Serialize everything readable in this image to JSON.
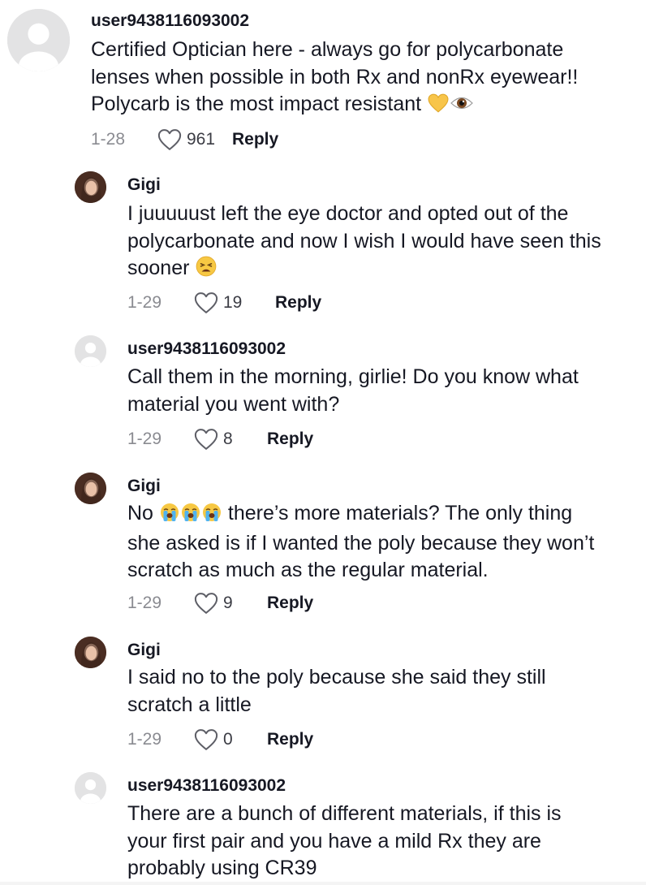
{
  "comments": [
    {
      "username": "user9438116093002",
      "avatar": "default-avatar-icon",
      "text_lines": [
        "Certified Optician here - always go for polycarbonate",
        "lenses when possible in both Rx and nonRx eyewear!!",
        "Polycarb is the most impact resistant"
      ],
      "emojis": [
        "yellow-heart-icon",
        "eye-icon"
      ],
      "date": "1-28",
      "likes": "961",
      "reply_label": "Reply"
    },
    {
      "username": "Gigi",
      "avatar": "profile-photo",
      "text_lines": [
        "I juuuuust left the eye doctor and opted out of the",
        "polycarbonate and now I wish I would have seen this",
        "sooner"
      ],
      "emojis": [
        "tired-face-icon"
      ],
      "date": "1-29",
      "likes": "19",
      "reply_label": "Reply"
    },
    {
      "username": "user9438116093002",
      "avatar": "default-avatar-icon",
      "text_lines": [
        "Call them in the morning, girlie! Do you know what",
        "material you went with?"
      ],
      "date": "1-29",
      "likes": "8",
      "reply_label": "Reply"
    },
    {
      "username": "Gigi",
      "avatar": "profile-photo",
      "text_prefix": "No",
      "text_first_rest": "there’s more materials? The only thing",
      "emojis": [
        "loudly-crying-face-icon",
        "loudly-crying-face-icon",
        "loudly-crying-face-icon"
      ],
      "text_lines": [
        "she asked is if I wanted the poly because they won’t",
        "scratch as much as the regular material."
      ],
      "date": "1-29",
      "likes": "9",
      "reply_label": "Reply"
    },
    {
      "username": "Gigi",
      "avatar": "profile-photo",
      "text_lines": [
        "I said no to the poly because she said they still",
        "scratch a little"
      ],
      "date": "1-29",
      "likes": "0",
      "reply_label": "Reply"
    },
    {
      "username": "user9438116093002",
      "avatar": "default-avatar-icon",
      "text_lines": [
        "There are a bunch of different materials, if this is",
        "your first pair and you have a mild Rx they are",
        "probably using CR39"
      ]
    }
  ],
  "icons": {
    "like": "heart-outline-icon"
  },
  "colors": {
    "text": "#161823",
    "secondary": "#8a8b91",
    "avatar_bg": "#e3e3e4",
    "avatar_fg": "#ffffff"
  }
}
